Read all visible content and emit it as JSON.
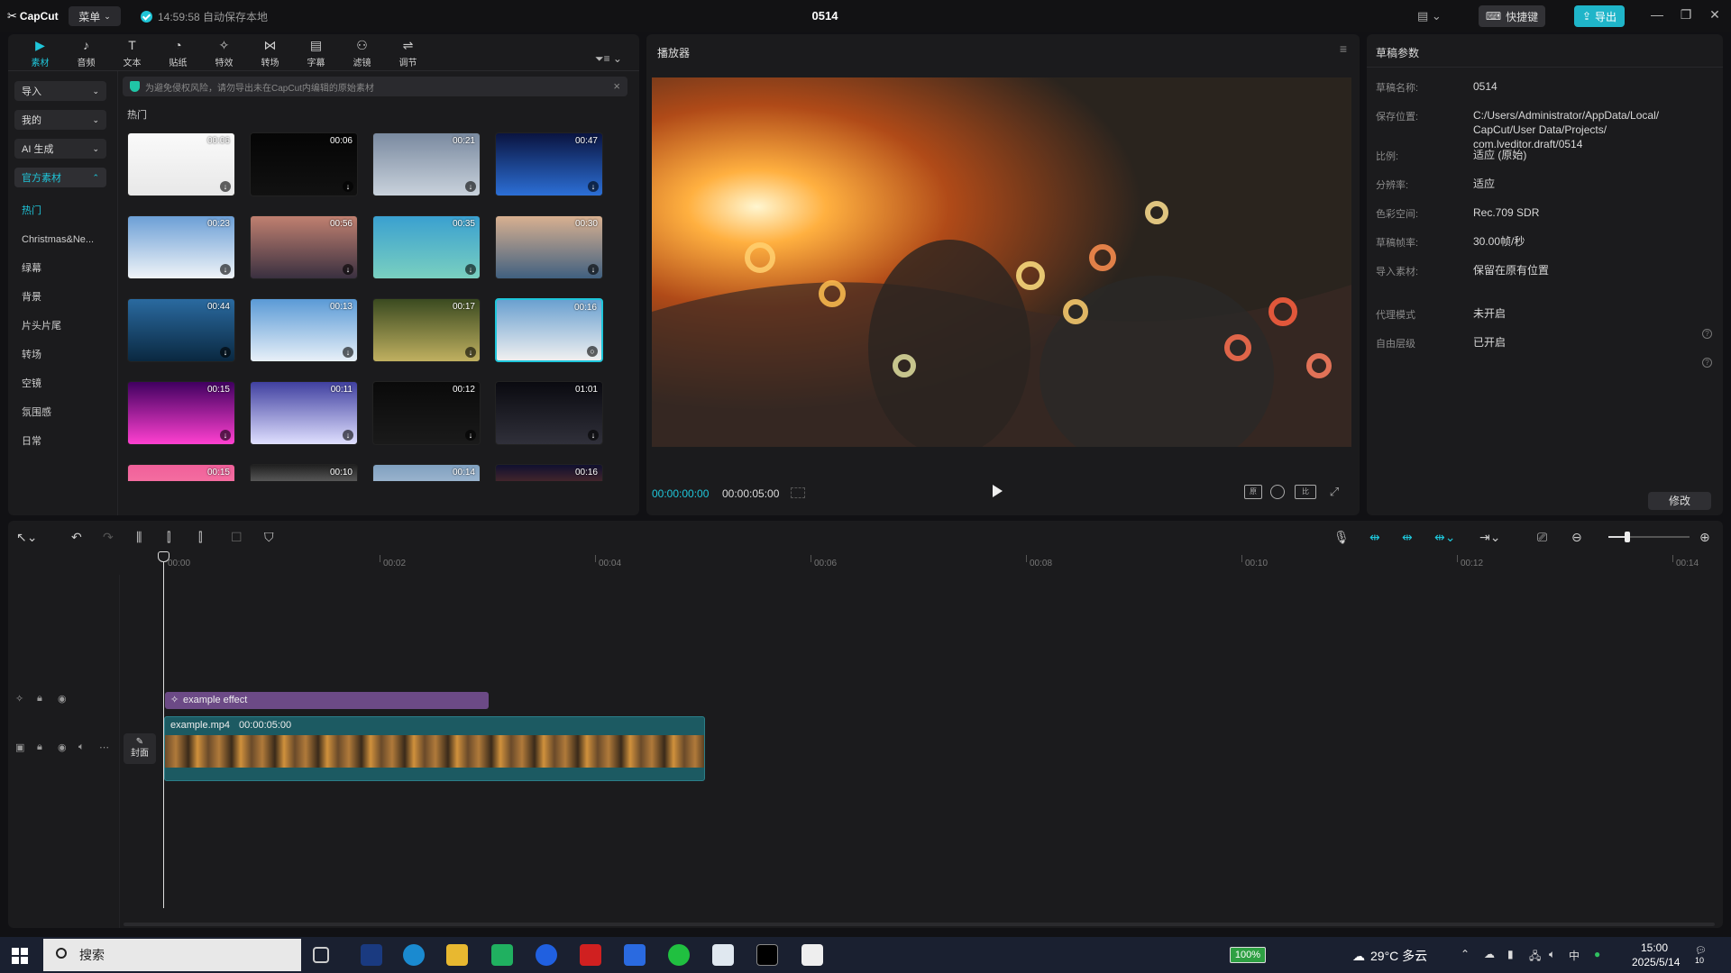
{
  "app": {
    "name": "CapCut",
    "menu_label": "菜单",
    "autosave": "14:59:58 自动保存本地",
    "project_title": "0514",
    "shortcut_label": "快捷键",
    "export_label": "导出"
  },
  "tool_tabs": [
    {
      "label": "素材",
      "icon": "media-icon"
    },
    {
      "label": "音频",
      "icon": "audio-icon"
    },
    {
      "label": "文本",
      "icon": "text-icon"
    },
    {
      "label": "贴纸",
      "icon": "sticker-icon"
    },
    {
      "label": "特效",
      "icon": "effects-icon"
    },
    {
      "label": "转场",
      "icon": "transition-icon"
    },
    {
      "label": "字幕",
      "icon": "caption-icon"
    },
    {
      "label": "滤镜",
      "icon": "filter-icon"
    },
    {
      "label": "调节",
      "icon": "adjust-icon"
    }
  ],
  "sidebar": {
    "dropdowns": [
      "导入",
      "我的",
      "AI 生成",
      "官方素材"
    ],
    "items": [
      "热门",
      "Christmas&Ne...",
      "绿幕",
      "背景",
      "片头片尾",
      "转场",
      "空镜",
      "氛围感",
      "日常"
    ]
  },
  "notice": "为避免侵权风险，请勿导出未在CapCut内编辑的原始素材",
  "section_label": "热门",
  "thumbnails": [
    {
      "dur": "00:06"
    },
    {
      "dur": "00:06"
    },
    {
      "dur": "00:21"
    },
    {
      "dur": "00:47"
    },
    {
      "dur": "00:23"
    },
    {
      "dur": "00:56"
    },
    {
      "dur": "00:35"
    },
    {
      "dur": "00:30"
    },
    {
      "dur": "00:44"
    },
    {
      "dur": "00:13"
    },
    {
      "dur": "00:17"
    },
    {
      "dur": "00:16"
    },
    {
      "dur": "00:15"
    },
    {
      "dur": "00:11"
    },
    {
      "dur": "00:12"
    },
    {
      "dur": "01:01"
    },
    {
      "dur": "00:15"
    },
    {
      "dur": "00:10"
    },
    {
      "dur": "00:14"
    },
    {
      "dur": "00:16"
    }
  ],
  "thumb_colors": [
    [
      "#fafafa",
      "#e8e8e8"
    ],
    [
      "#050505",
      "#111"
    ],
    [
      "#7a8aa0",
      "#c9d2dc"
    ],
    [
      "#0a1440",
      "#2c6fd6"
    ],
    [
      "#6c9fd6",
      "#f0f4f8"
    ],
    [
      "#c08070",
      "#3a3040"
    ],
    [
      "#3aa0d0",
      "#7ad0c0"
    ],
    [
      "#d8b090",
      "#406080"
    ],
    [
      "#2a6aa0",
      "#0a2840"
    ],
    [
      "#5a9ad6",
      "#e8f0f8"
    ],
    [
      "#3a4a20",
      "#c0b060"
    ],
    [
      "#6aa0d0",
      "#f0f0f0"
    ],
    [
      "#400060",
      "#ff40d0"
    ],
    [
      "#4040a0",
      "#e0e0ff"
    ],
    [
      "#0a0a0a",
      "#1a1a1a"
    ],
    [
      "#0a0a10",
      "#30303a"
    ],
    [
      "#f0609a",
      "#ff90b0"
    ],
    [
      "#202020",
      "#f0f0f0"
    ],
    [
      "#80a0c0",
      "#e0e8f0"
    ],
    [
      "#101030",
      "#d06020"
    ]
  ],
  "player": {
    "title": "播放器",
    "current": "00:00:00:00",
    "total": "00:00:05:00"
  },
  "props": {
    "title": "草稿参数",
    "rows": [
      {
        "label": "草稿名称:",
        "value": "0514"
      },
      {
        "label": "保存位置:",
        "value": "C:/Users/Administrator/AppData/Local/ CapCut/User Data/Projects/ com.lveditor.draft/0514"
      },
      {
        "label": "比例:",
        "value": "适应 (原始)"
      },
      {
        "label": "分辨率:",
        "value": "适应"
      },
      {
        "label": "色彩空间:",
        "value": "Rec.709 SDR"
      },
      {
        "label": "草稿帧率:",
        "value": "30.00帧/秒"
      },
      {
        "label": "导入素材:",
        "value": "保留在原有位置"
      },
      {
        "label": "代理模式",
        "value": "未开启"
      },
      {
        "label": "自由层级",
        "value": "已开启"
      }
    ],
    "modify_label": "修改"
  },
  "timeline": {
    "ticks": [
      "00:00",
      "00:02",
      "00:04",
      "00:06",
      "00:08",
      "00:10",
      "00:12",
      "00:14"
    ],
    "effect_clip": "example effect",
    "video_clip_name": "example.mp4",
    "video_clip_dur": "00:00:05:00",
    "cover_label": "封面"
  },
  "taskbar": {
    "search": "搜索",
    "battery": "100%",
    "weather": "29°C 多云",
    "ime": "中",
    "time": "15:00",
    "date": "2025/5/14",
    "notifications": "10"
  }
}
